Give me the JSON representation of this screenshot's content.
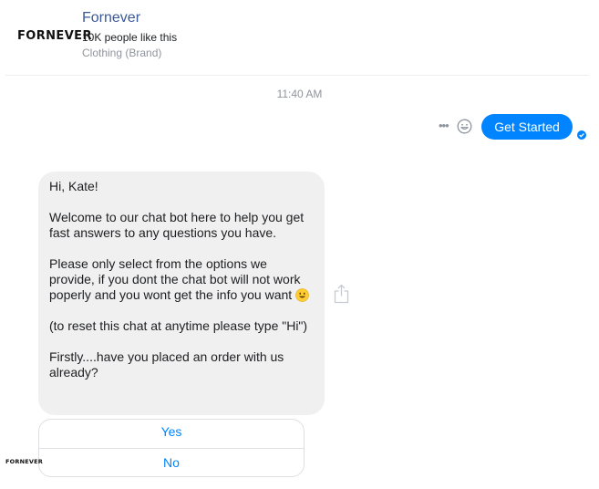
{
  "header": {
    "logo_text": "FORNEVER",
    "page_name": "Fornever",
    "likes": "10K people like this",
    "category": "Clothing (Brand)"
  },
  "conversation": {
    "timestamp": "11:40 AM",
    "user_message": "Get Started",
    "bot_message": {
      "paragraphs": [
        "Hi, Kate!",
        "Welcome to our chat bot here to help you get fast answers to any questions you have.",
        "Please only select from the options we provide, if you dont the chat bot will not work poperly and you wont get the info you want",
        "(to reset this chat at anytime please type \"Hi\")",
        "Firstly....have you placed an order with us already?"
      ],
      "emoji": "smiley-emoji"
    },
    "quick_replies": [
      "Yes",
      "No"
    ],
    "sender_avatar_text": "FORNEVER"
  },
  "icons": {
    "more": "more-options-icon",
    "react": "smile-icon",
    "delivered": "check-circle-icon",
    "share": "share-icon"
  },
  "colors": {
    "accent": "#0084ff",
    "page_name": "#3b5998",
    "bubble_gray": "#f1f0f0",
    "muted_text": "#90949c"
  }
}
